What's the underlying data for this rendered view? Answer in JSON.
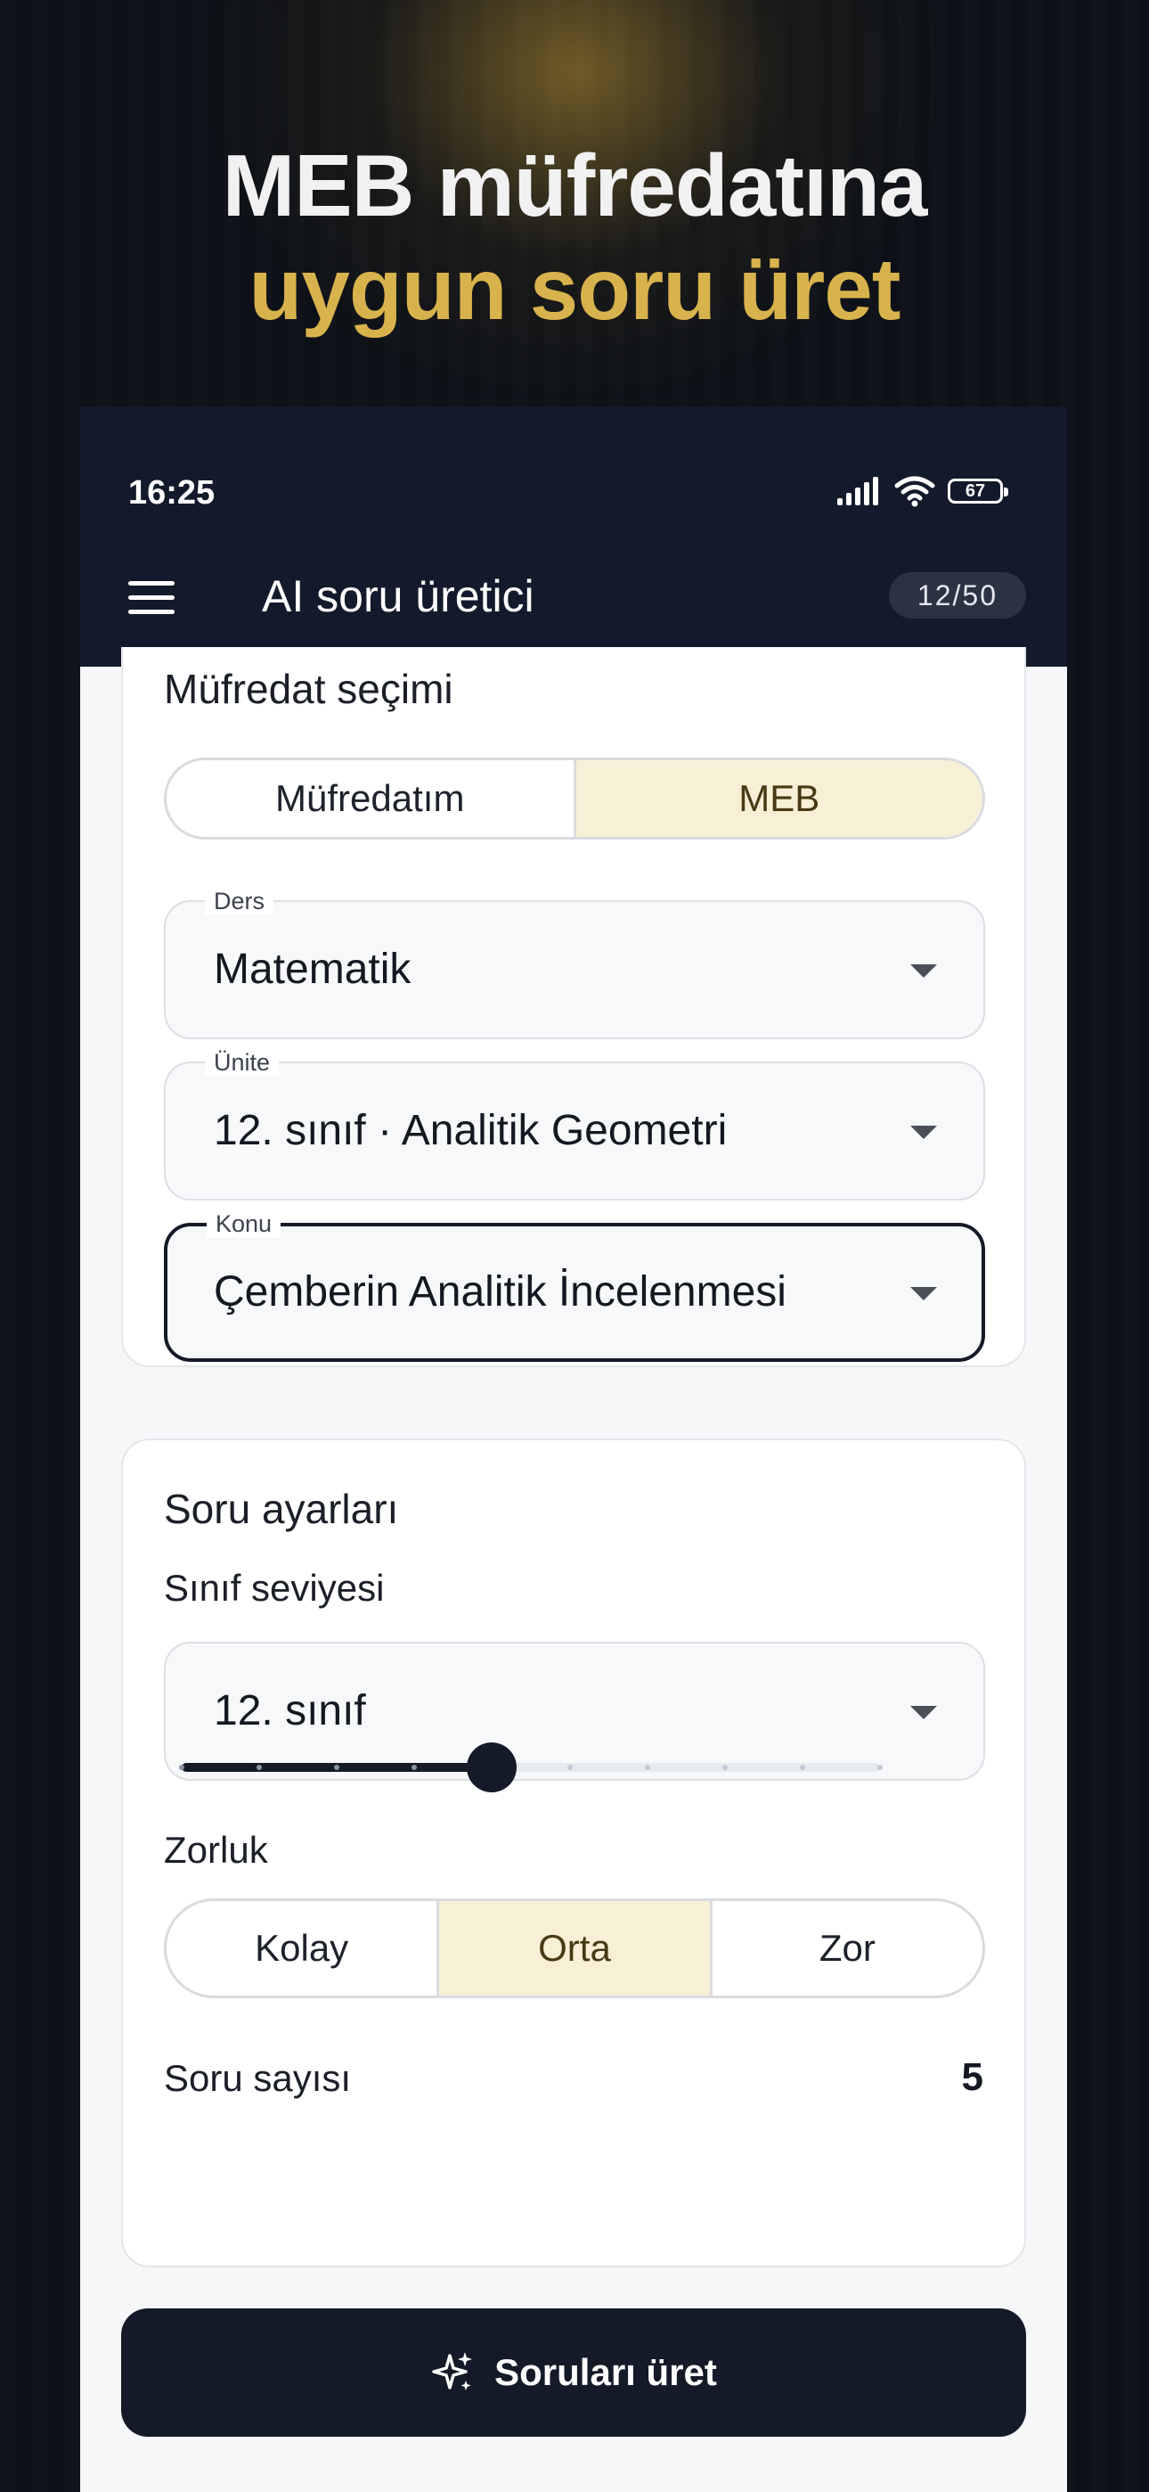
{
  "headline": {
    "line1": "MEB müfredatına",
    "line2": "uygun soru üret"
  },
  "status": {
    "time": "16:25",
    "battery": "67"
  },
  "appbar": {
    "title": "AI soru üretici",
    "quota": "12/50"
  },
  "curriculum": {
    "title": "Müfredat seçimi",
    "source_options": [
      "Müfredatım",
      "MEB"
    ],
    "selected_source": "MEB",
    "subject": {
      "label": "Ders",
      "value": "Matematik"
    },
    "unit": {
      "label": "Ünite",
      "value": "12. sınıf · Analitik Geometri"
    },
    "topic": {
      "label": "Konu",
      "value": "Çemberin Analitik İncelenmesi"
    }
  },
  "settings": {
    "title": "Soru ayarları",
    "grade_label": "Sınıf seviyesi",
    "grade_value": "12. sınıf",
    "difficulty_label": "Zorluk",
    "difficulty_options": [
      "Kolay",
      "Orta",
      "Zor"
    ],
    "selected_difficulty": "Orta",
    "count_label": "Soru sayısı",
    "count_value": "5",
    "count_min": 1,
    "count_max": 10
  },
  "generate_button": {
    "label": "Soruları üret"
  },
  "colors": {
    "dark": "#141a27",
    "accent": "#d8b24c",
    "selected_bg": "#f7efd6"
  },
  "icons": {
    "menu": "hamburger-menu-icon",
    "sparkle": "sparkle-icon",
    "dropdown": "chevron-down-icon"
  }
}
